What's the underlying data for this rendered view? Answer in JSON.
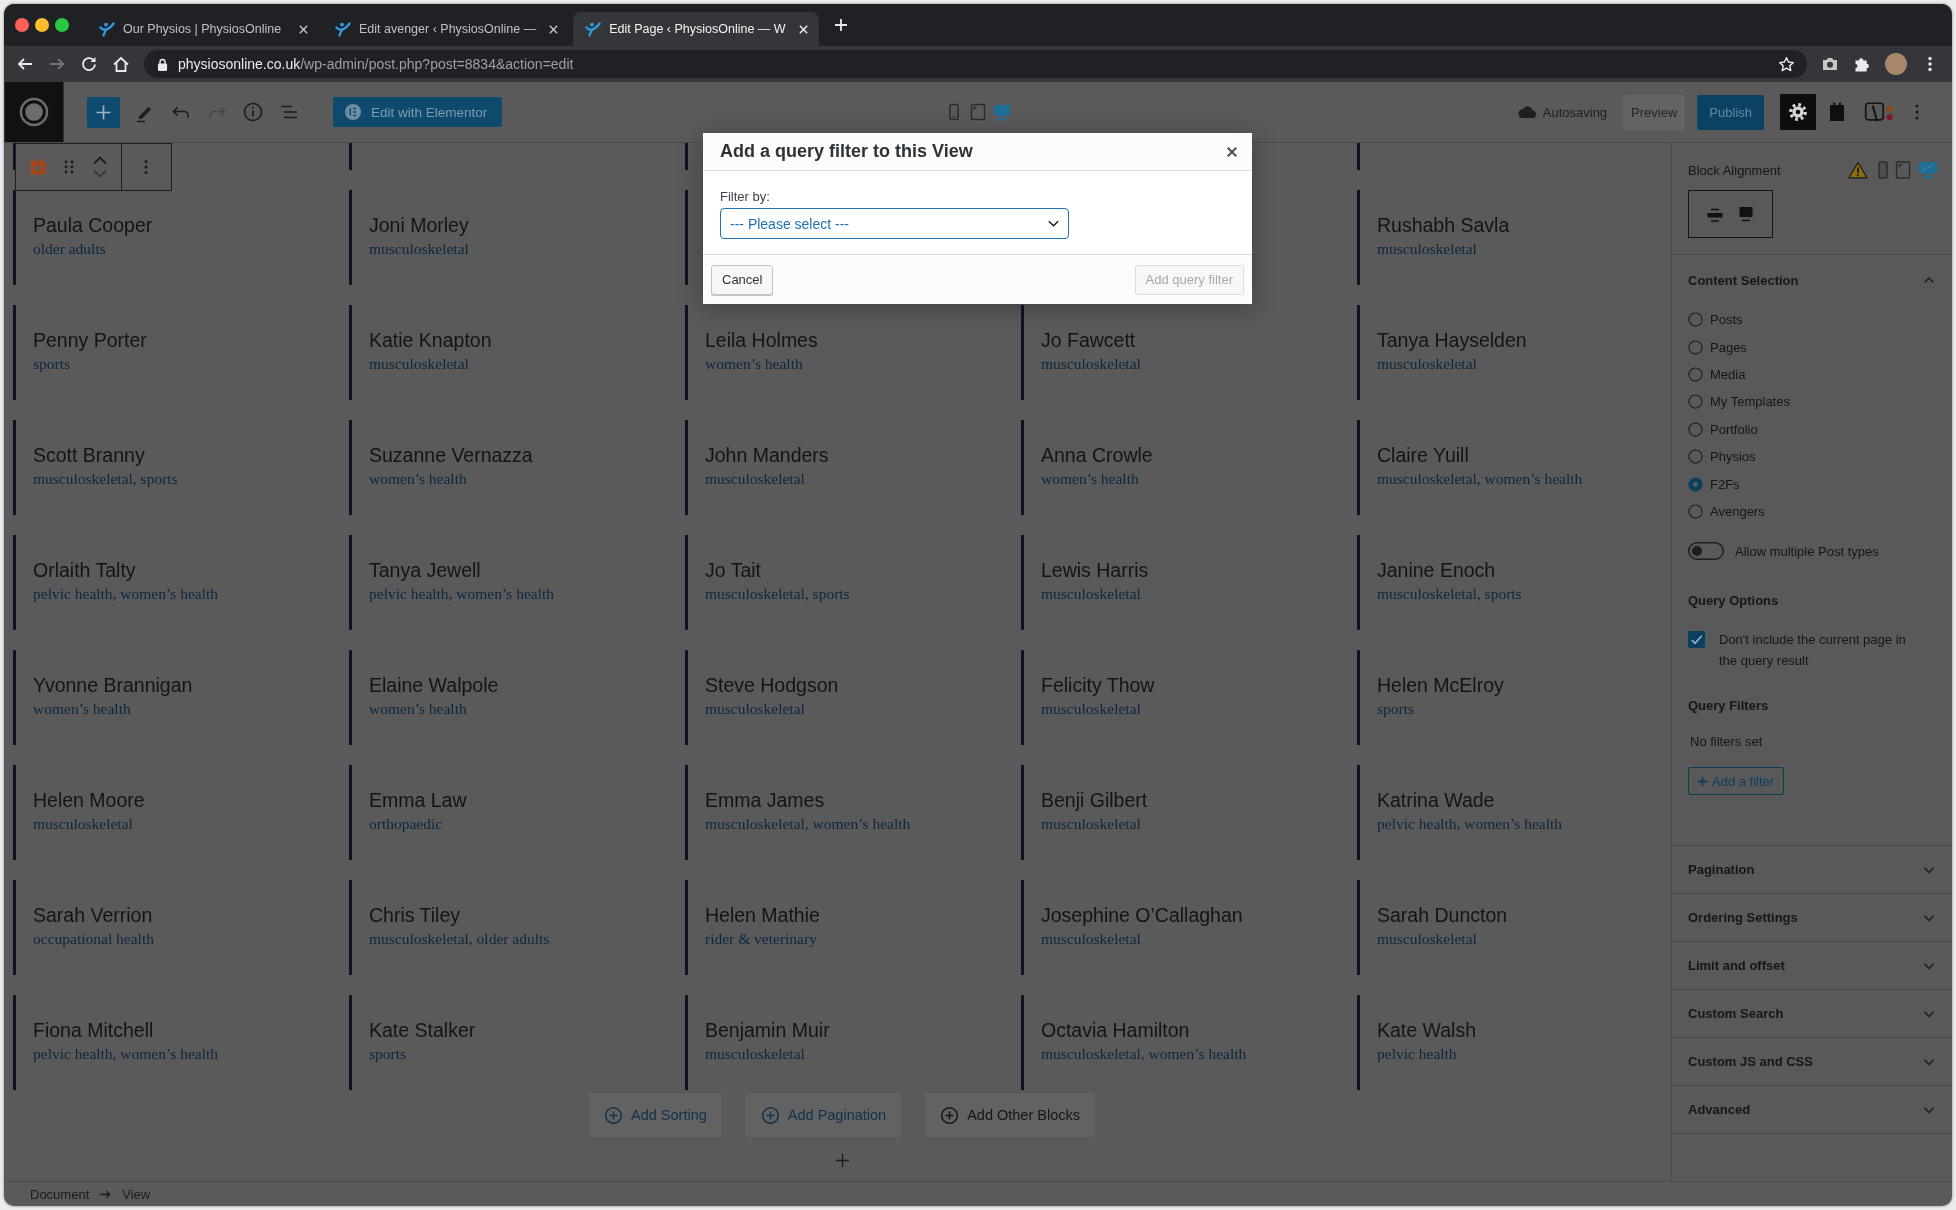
{
  "browser": {
    "tabs": [
      {
        "title": "Our Physios | PhysiosOnline",
        "selected": false
      },
      {
        "title": "Edit avenger ‹ PhysiosOnline —",
        "selected": false
      },
      {
        "title": "Edit Page ‹ PhysiosOnline — W",
        "selected": true
      }
    ],
    "nav": [
      {
        "kind": "back",
        "disabled": false
      },
      {
        "kind": "forward",
        "disabled": true
      }
    ],
    "url": {
      "host": "physiosonline.co.uk",
      "path": "/wp-admin/post.php?post=8834&action=edit"
    }
  },
  "editor_toolbar": {
    "history": [
      {
        "kind": "undo",
        "disabled": false
      },
      {
        "kind": "redo",
        "disabled": true
      }
    ],
    "edit_button": "Edit with Elementor",
    "devices": [
      {
        "kind": "mobile",
        "selected": false
      },
      {
        "kind": "tablet",
        "selected": false
      },
      {
        "kind": "desktop",
        "selected": true
      }
    ],
    "save_status": "Autosaving",
    "preview_button": "Preview",
    "publish_button": "Publish"
  },
  "modal": {
    "title": "Add a query filter to this View",
    "field_label": "Filter by:",
    "select_value": "--- Please select ---",
    "cancel_button": "Cancel",
    "submit": {
      "label": "Add query filter",
      "disabled": true
    }
  },
  "columns": [
    {
      "items": [
        {
          "title": "Paula Cooper",
          "subtitle": "older adults"
        },
        {
          "title": "Penny Porter",
          "subtitle": "sports"
        },
        {
          "title": "Scott Branny",
          "subtitle": "musculoskeletal, sports"
        },
        {
          "title": "Orlaith Talty",
          "subtitle": "pelvic health, women’s health"
        },
        {
          "title": "Yvonne Brannigan",
          "subtitle": "women’s health"
        },
        {
          "title": "Helen Moore",
          "subtitle": "musculoskeletal"
        },
        {
          "title": "Sarah Verrion",
          "subtitle": "occupational health"
        },
        {
          "title": "Fiona Mitchell",
          "subtitle": "pelvic health, women’s health"
        }
      ]
    },
    {
      "items": [
        {
          "title": "Joni Morley",
          "subtitle": "musculoskeletal"
        },
        {
          "title": "Katie Knapton",
          "subtitle": "musculoskeletal"
        },
        {
          "title": "Suzanne Vernazza",
          "subtitle": "women’s health"
        },
        {
          "title": "Tanya Jewell",
          "subtitle": "pelvic health, women’s health"
        },
        {
          "title": "Elaine Walpole",
          "subtitle": "women’s health"
        },
        {
          "title": "Emma Law",
          "subtitle": "orthopaedic"
        },
        {
          "title": "Chris Tiley",
          "subtitle": "musculoskeletal, older adults"
        },
        {
          "title": "Kate Stalker",
          "subtitle": "sports"
        }
      ]
    },
    {
      "items": [
        {
          "title": "Leila Holmes",
          "subtitle": "women’s health"
        },
        {
          "title": "John Manders",
          "subtitle": "musculoskeletal"
        },
        {
          "title": "Jo Tait",
          "subtitle": "musculoskeletal, sports"
        },
        {
          "title": "Steve Hodgson",
          "subtitle": "musculoskeletal"
        },
        {
          "title": "Emma James",
          "subtitle": "musculoskeletal, women’s health"
        },
        {
          "title": "Helen Mathie",
          "subtitle": "rider & veterinary"
        },
        {
          "title": "Benjamin Muir",
          "subtitle": "musculoskeletal"
        }
      ]
    },
    {
      "items": [
        {
          "title": "Jo Fawcett",
          "subtitle": "musculoskeletal"
        },
        {
          "title": "Anna Crowle",
          "subtitle": "women’s health"
        },
        {
          "title": "Lewis Harris",
          "subtitle": "musculoskeletal"
        },
        {
          "title": "Felicity Thow",
          "subtitle": "musculoskeletal"
        },
        {
          "title": "Benji Gilbert",
          "subtitle": "musculoskeletal"
        },
        {
          "title": "Josephine O’Callaghan",
          "subtitle": "musculoskeletal"
        },
        {
          "title": "Octavia Hamilton",
          "subtitle": "musculoskeletal, women’s health"
        }
      ]
    },
    {
      "items": [
        {
          "title": "Rushabh Savla",
          "subtitle": "musculoskeletal"
        },
        {
          "title": "Tanya Hayselden",
          "subtitle": "musculoskeletal"
        },
        {
          "title": "Claire Yuill",
          "subtitle": "musculoskeletal, women’s health"
        },
        {
          "title": "Janine Enoch",
          "subtitle": "musculoskeletal, sports"
        },
        {
          "title": "Helen McElroy",
          "subtitle": "sports"
        },
        {
          "title": "Katrina Wade",
          "subtitle": "pelvic health, women’s health"
        },
        {
          "title": "Sarah Duncton",
          "subtitle": "musculoskeletal"
        },
        {
          "title": "Kate Walsh",
          "subtitle": "pelvic health"
        }
      ]
    }
  ],
  "actions": [
    {
      "label": "Add Sorting",
      "kind": "link"
    },
    {
      "label": "Add Pagination",
      "kind": "link"
    },
    {
      "label": "Add Other Blocks",
      "kind": "plain"
    }
  ],
  "sidebar": {
    "block_alignment": {
      "label": "Block Alignment",
      "devices": [
        {
          "kind": "mobile",
          "selected": false
        },
        {
          "kind": "tablet",
          "selected": false
        },
        {
          "kind": "desktop",
          "selected": true
        }
      ]
    },
    "content_selection": {
      "title": "Content Selection",
      "expanded": true,
      "post_types": [
        {
          "label": "Posts",
          "selected": false
        },
        {
          "label": "Pages",
          "selected": false
        },
        {
          "label": "Media",
          "selected": false
        },
        {
          "label": "My Templates",
          "selected": false
        },
        {
          "label": "Portfolio",
          "selected": false
        },
        {
          "label": "Physios",
          "selected": false
        },
        {
          "label": "F2Fs",
          "selected": true
        },
        {
          "label": "Avengers",
          "selected": false
        }
      ],
      "allow_multiple": {
        "label": "Allow multiple Post types",
        "on": false
      },
      "query_options": {
        "title": "Query Options",
        "exclude_current": {
          "label": "Don't include the current page in the query result",
          "checked": true
        }
      },
      "query_filters": {
        "title": "Query Filters",
        "empty_text": "No filters set",
        "add_button": "Add a filter"
      }
    },
    "panels": [
      {
        "title": "Pagination",
        "expanded": false
      },
      {
        "title": "Ordering Settings",
        "expanded": false
      },
      {
        "title": "Limit and offset",
        "expanded": false
      },
      {
        "title": "Custom Search",
        "expanded": false
      },
      {
        "title": "Custom JS and CSS",
        "expanded": false
      },
      {
        "title": "Advanced",
        "expanded": false
      }
    ]
  },
  "breadcrumb": [
    "Document",
    "View"
  ]
}
